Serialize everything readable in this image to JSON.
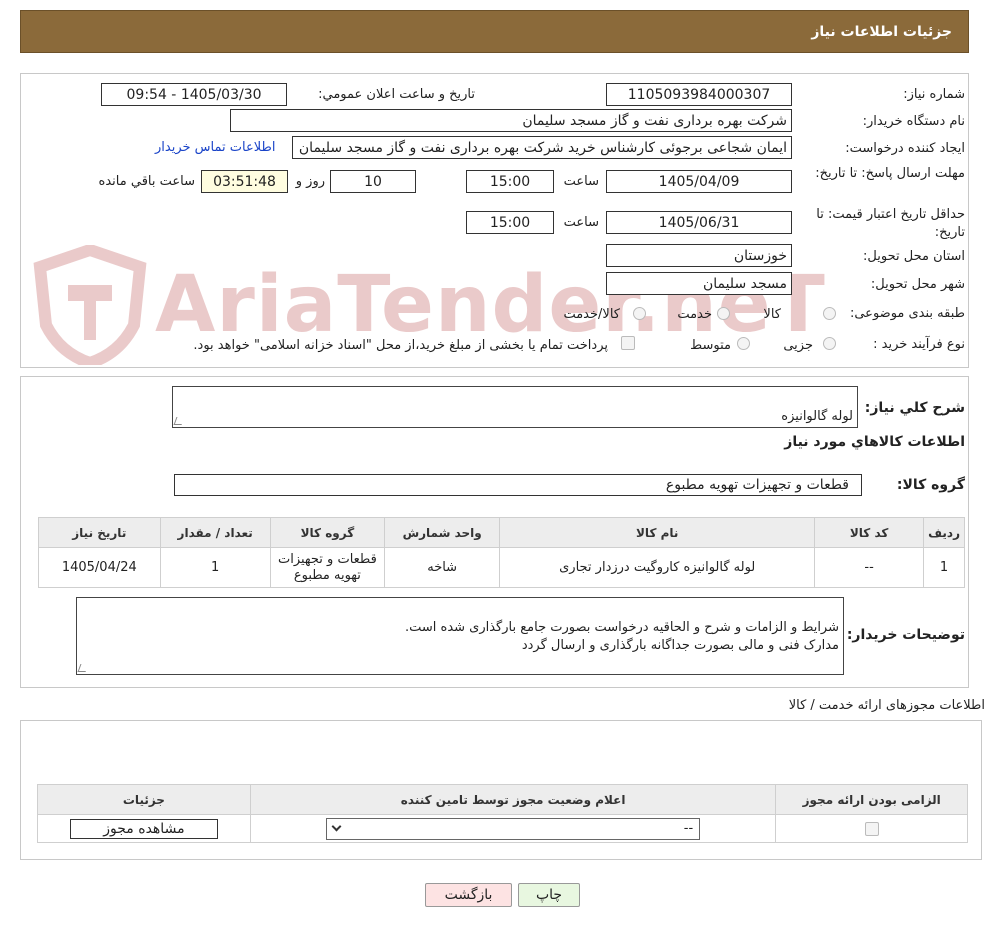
{
  "header": {
    "title": "جزئیات اطلاعات نیاز"
  },
  "info": {
    "need_number_label": "شماره نیاز:",
    "need_number": "1105093984000307",
    "announce_label": "تاریخ و ساعت اعلان عمومي:",
    "announce_value": "1405/03/30 - 09:54",
    "buyer_label": "نام دستگاه خریدار:",
    "buyer_value": "شرکت بهره برداری نفت و گاز مسجد سلیمان",
    "creator_label": "ایجاد کننده درخواست:",
    "creator_value": "ایمان شجاعی برجوئی کارشناس خرید شرکت بهره برداری نفت و گاز مسجد سلیمان",
    "contact_link": "اطلاعات تماس خریدار",
    "deadline_label": "مهلت ارسال پاسخ: تا تاریخ:",
    "deadline_date": "1405/04/09",
    "time_label": "ساعت",
    "deadline_time": "15:00",
    "days_value": "10",
    "days_label": "روز و",
    "remaining_time": "03:51:48",
    "remaining_label": "ساعت باقي مانده",
    "validity_label": "حداقل تاریخ اعتبار قیمت: تا تاریخ:",
    "validity_date": "1405/06/31",
    "validity_time": "15:00",
    "province_label": "استان محل تحویل:",
    "province_value": "خوزستان",
    "city_label": "شهر محل تحویل:",
    "city_value": "مسجد سلیمان",
    "category_label": "طبقه بندی موضوعی:",
    "category_options": [
      "کالا",
      "خدمت",
      "کالا/خدمت"
    ],
    "process_label": "نوع فرآیند خرید :",
    "process_options": [
      "جزیی",
      "متوسط"
    ],
    "payment_note": "پرداخت تمام یا بخشی از مبلغ خرید،از محل \"اسناد خزانه اسلامی\" خواهد بود."
  },
  "watermark": "AriaTender.neT",
  "summary": {
    "label": "شرح کلي نیاز:",
    "value": "لوله گالوانیزه",
    "goods_title": "اطلاعات کالاهاي مورد نیاز",
    "group_label": "گروه کالا:",
    "group_value": "قطعات و تجهیزات تهویه مطبوع"
  },
  "goods_table": {
    "headers": [
      "ردیف",
      "کد کالا",
      "نام کالا",
      "واحد شمارش",
      "گروه کالا",
      "تعداد / مقدار",
      "تاریخ نیاز"
    ],
    "rows": [
      [
        "1",
        "--",
        "لوله گالوانیزه کاروگیت درزدار تجاری",
        "شاخه",
        "قطعات و تجهیزات تهویه مطبوع",
        "1",
        "1405/04/24"
      ]
    ]
  },
  "buyer_notes": {
    "label": "توضیحات خریدار:",
    "text": "شرایط و الزامات و شرح و الحاقیه درخواست بصورت جامع بارگذاری شده است.\nمدارک فنی و مالی بصورت جداگانه بارگذاری و ارسال گردد"
  },
  "permits": {
    "title": "اطلاعات مجوزهای ارائه خدمت / کالا",
    "headers": [
      "الزامی بودن ارائه مجوز",
      "اعلام وضعیت مجوز توسط تامین کننده",
      "جزئیات"
    ],
    "select_value": "--",
    "view_button": "مشاهده مجوز"
  },
  "buttons": {
    "print": "چاپ",
    "back": "بازگشت"
  },
  "colors": {
    "header_bg": "#8b6a3a",
    "link": "#1a44c8",
    "print_bg": "#e8f7e0",
    "back_bg": "#fde3e3"
  }
}
